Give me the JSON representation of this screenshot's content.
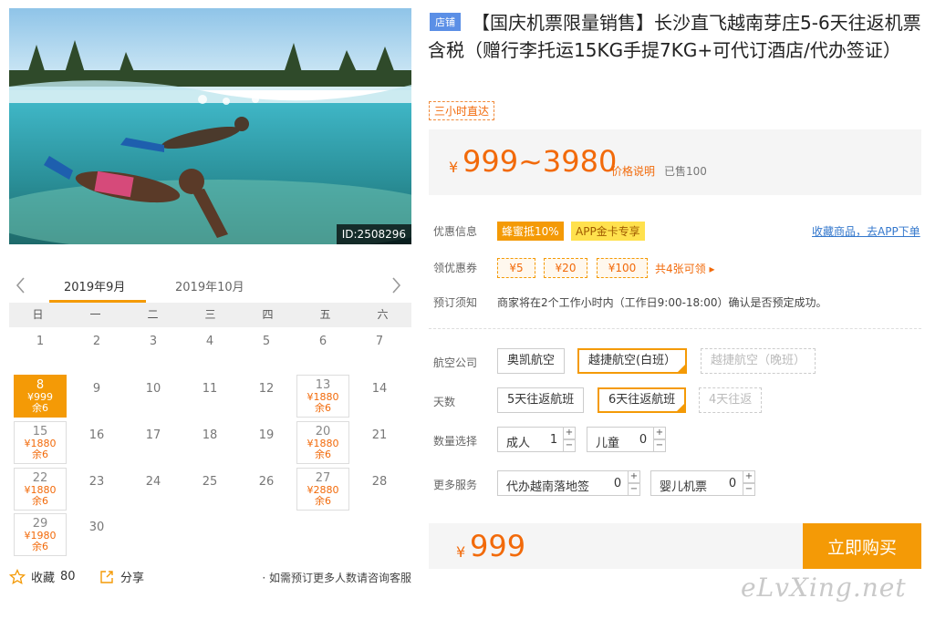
{
  "image": {
    "id_label": "ID:2508296"
  },
  "calendar": {
    "months": [
      "2019年9月",
      "2019年10月"
    ],
    "weekdays": [
      "日",
      "一",
      "二",
      "三",
      "四",
      "五",
      "六"
    ],
    "days": [
      {
        "day": "1"
      },
      {
        "day": "2"
      },
      {
        "day": "3"
      },
      {
        "day": "4"
      },
      {
        "day": "5"
      },
      {
        "day": "6"
      },
      {
        "day": "7"
      },
      {
        "day": "8",
        "price": "¥999",
        "remain": "余6",
        "selected": true
      },
      {
        "day": "9"
      },
      {
        "day": "10"
      },
      {
        "day": "11"
      },
      {
        "day": "12"
      },
      {
        "day": "13",
        "price": "¥1880",
        "remain": "余6"
      },
      {
        "day": "14"
      },
      {
        "day": "15",
        "price": "¥1880",
        "remain": "余6"
      },
      {
        "day": "16"
      },
      {
        "day": "17"
      },
      {
        "day": "18"
      },
      {
        "day": "19"
      },
      {
        "day": "20",
        "price": "¥1880",
        "remain": "余6"
      },
      {
        "day": "21"
      },
      {
        "day": "22",
        "price": "¥1880",
        "remain": "余6"
      },
      {
        "day": "23"
      },
      {
        "day": "24"
      },
      {
        "day": "25"
      },
      {
        "day": "26"
      },
      {
        "day": "27",
        "price": "¥2880",
        "remain": "余6"
      },
      {
        "day": "28"
      },
      {
        "day": "29",
        "price": "¥1980",
        "remain": "余6"
      },
      {
        "day": "30"
      }
    ]
  },
  "share": {
    "fav_label": "收藏",
    "fav_count": "80",
    "share_label": "分享",
    "note": "· 如需预订更多人数请咨询客服"
  },
  "product": {
    "shop_badge": "店铺",
    "title": "【国庆机票限量销售】长沙直飞越南芽庄5-6天往返机票含税（赠行李托运15KG手提7KG+可代订酒店/代办签证）",
    "tag": "三小时直达"
  },
  "price": {
    "currency": "¥",
    "range": "999~3980",
    "explain": "价格说明",
    "sold": "已售100"
  },
  "promo": {
    "label": "优惠信息",
    "tags": [
      "蜂蜜抵10%",
      "APP金卡专享"
    ],
    "app_link": "收藏商品，去APP下单"
  },
  "coupons": {
    "label": "领优惠券",
    "items": [
      "¥5",
      "¥20",
      "¥100"
    ],
    "more": "共4张可领 ▸"
  },
  "booking": {
    "label": "预订须知",
    "text": "商家将在2个工作小时内（工作日9:00-18:00）确认是否预定成功。"
  },
  "airline": {
    "label": "航空公司",
    "options": [
      "奥凯航空",
      "越捷航空(白班）",
      "越捷航空（晚班）"
    ]
  },
  "days_opt": {
    "label": "天数",
    "options": [
      "5天往返航班",
      "6天往返航班",
      "4天往返"
    ]
  },
  "quantity": {
    "label": "数量选择",
    "adult_label": "成人",
    "adult_value": "1",
    "child_label": "儿童",
    "child_value": "0"
  },
  "services": {
    "label": "更多服务",
    "visa_label": "代办越南落地签",
    "visa_value": "0",
    "infant_label": "婴儿机票",
    "infant_value": "0"
  },
  "total": {
    "currency": "¥",
    "value": "999"
  },
  "buy_label": "立即购买",
  "watermark": "eLvXing.net",
  "colors": {
    "accent": "#f49a06",
    "price": "#f26a0a",
    "badge": "#5b8fe6",
    "link": "#3377cc"
  }
}
